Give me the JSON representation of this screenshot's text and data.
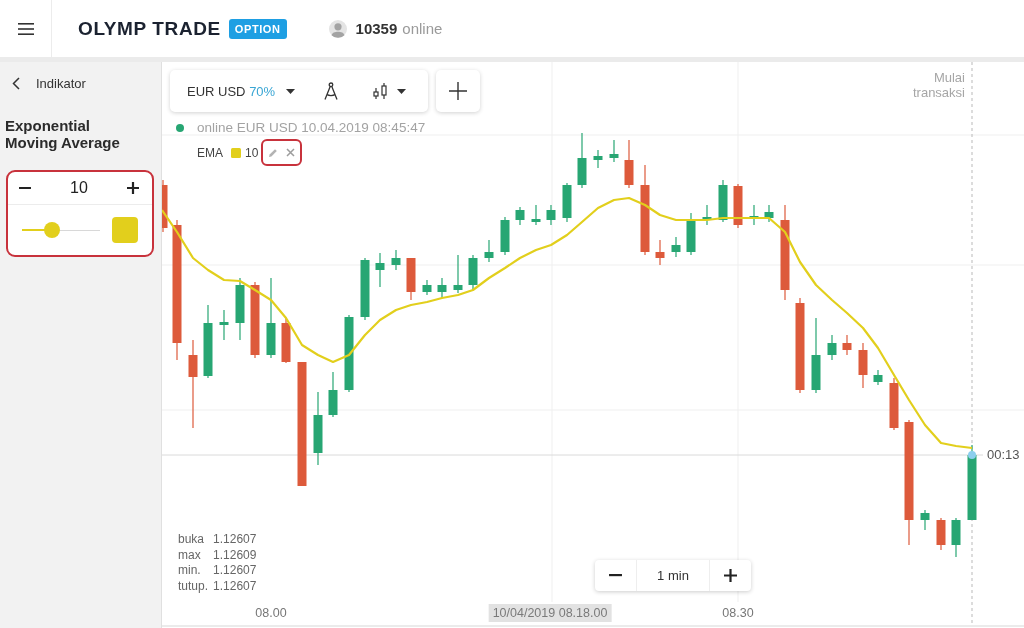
{
  "header": {
    "brand": "OLYMP TRADE",
    "badge": "OPTION",
    "online_count": "10359",
    "online_label": "online"
  },
  "sidebar": {
    "back_label": "Indikator",
    "title": "Exponential Moving Average",
    "period": "10",
    "thickness": {
      "level": 0.38
    },
    "color": "#e2cf1c"
  },
  "chart": {
    "asset": "EUR USD",
    "payout": "70%",
    "status": {
      "connected": true,
      "text": "online EUR USD 10.04.2019 08:45:47"
    },
    "indicator": {
      "name": "EMA",
      "color": "#e2cf1c",
      "period": "10"
    },
    "start_label": "Mulai transaksi",
    "timer": "00:13",
    "ohlc": [
      {
        "label": "buka",
        "value": "1.12607"
      },
      {
        "label": "max",
        "value": "1.12609"
      },
      {
        "label": "min.",
        "value": "1.12607"
      },
      {
        "label": "tutup.",
        "value": "1.12607"
      }
    ],
    "timeframe": "1 min",
    "x_axis": [
      {
        "label": "08.00",
        "kind": "tick"
      },
      {
        "label": "10/04/2019 08.18.00",
        "kind": "cursor"
      },
      {
        "label": "08.30",
        "kind": "tick"
      }
    ]
  }
}
